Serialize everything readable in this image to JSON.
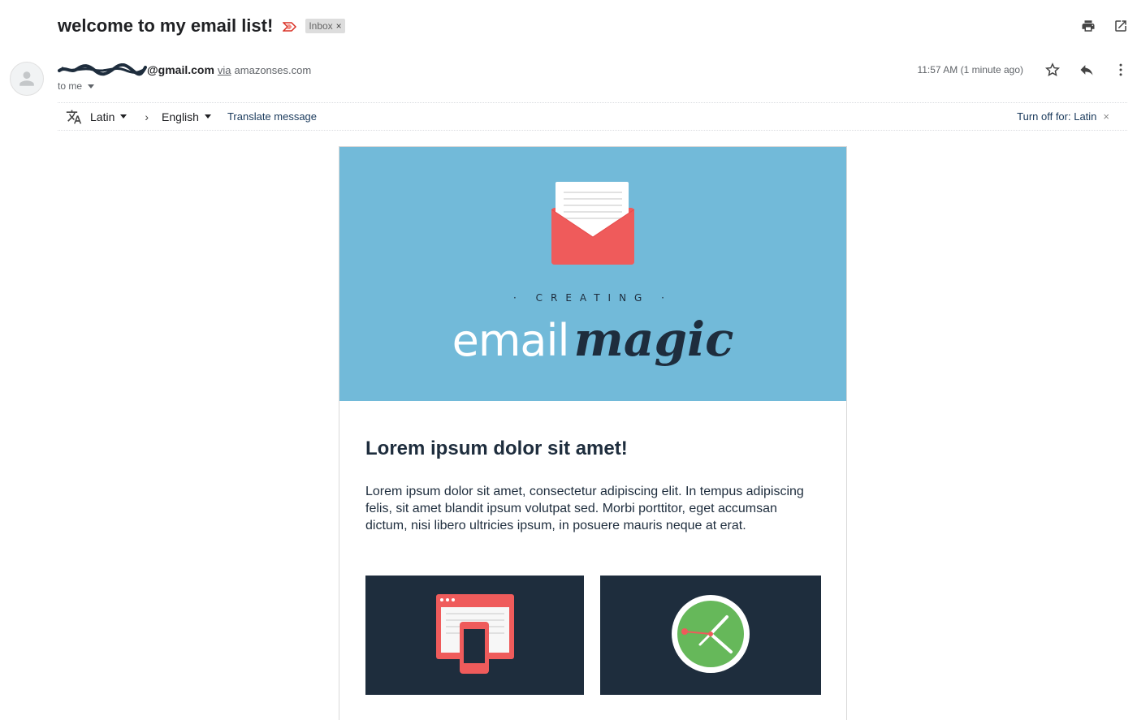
{
  "email": {
    "subject": "welcome to my email list!",
    "label": "Inbox",
    "sender_email": "@gmail.com",
    "via_label": "via",
    "via_domain": "amazonses.com",
    "recipient": "to me",
    "timestamp": "11:57 AM (1 minute ago)"
  },
  "translate": {
    "from_lang": "Latin",
    "to_lang": "English",
    "translate_link": "Translate message",
    "turn_off": "Turn off for: Latin"
  },
  "body": {
    "hero_kicker": "CREATING",
    "brand_light": "email",
    "brand_bold": "magic",
    "title": "Lorem ipsum dolor sit amet!",
    "paragraph": "Lorem ipsum dolor sit amet, consectetur adipiscing elit. In tempus adipiscing felis, sit amet blandit ipsum volutpat sed. Morbi porttitor, eget accumsan dictum, nisi libero ultricies ipsum, in posuere mauris neque at erat."
  },
  "icons": {
    "print": "print-icon",
    "open_new": "open-in-new-icon",
    "star": "star-icon",
    "reply": "reply-icon",
    "more": "more-vert-icon",
    "translate": "translate-icon",
    "avatar": "person-icon"
  },
  "colors": {
    "hero_bg": "#72bad9",
    "navy": "#1e2d3d",
    "coral": "#ef5b5b",
    "green": "#66b85a"
  }
}
